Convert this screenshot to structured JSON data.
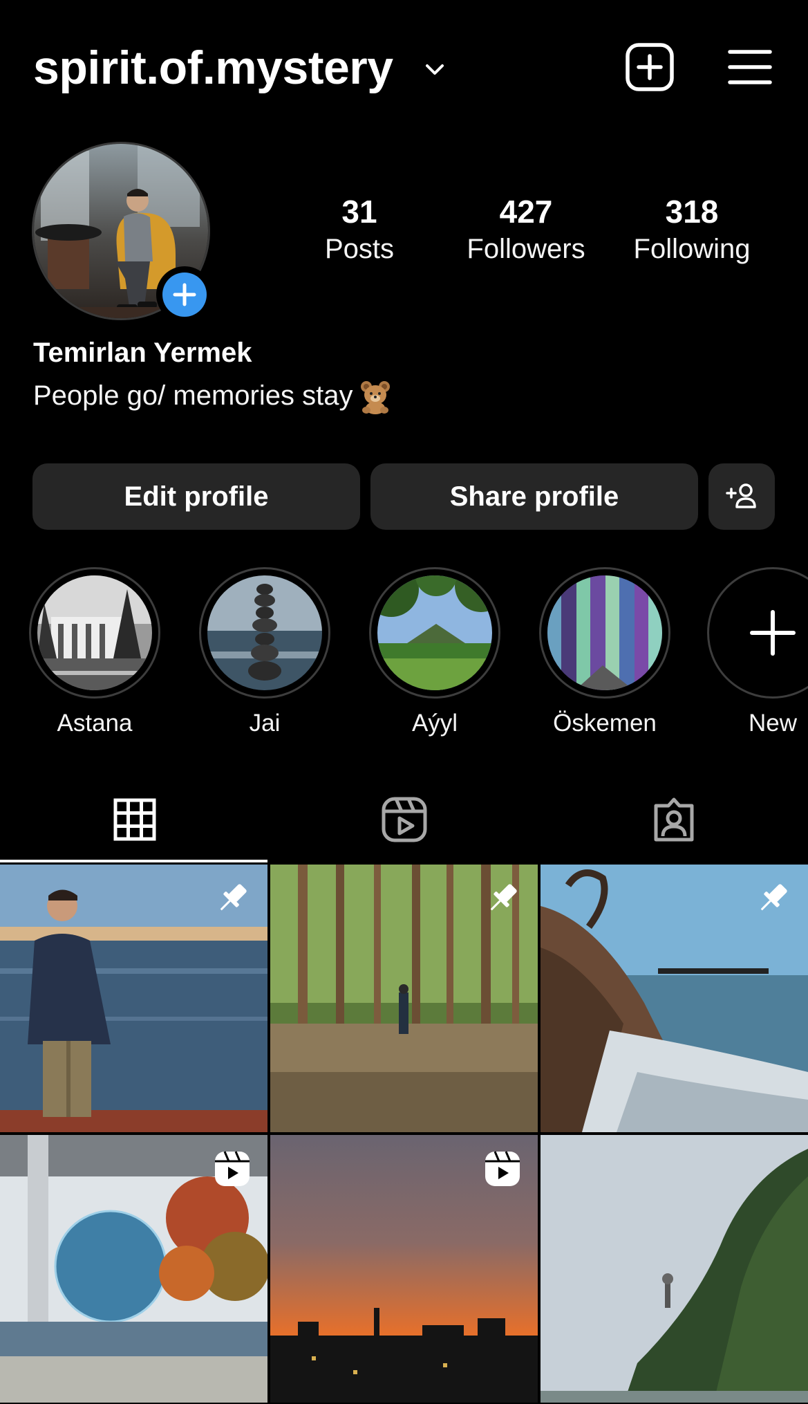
{
  "header": {
    "username": "spirit.of.mystery",
    "icons": [
      "chevron-down-icon",
      "new-post-icon",
      "menu-icon"
    ]
  },
  "profile": {
    "stats": [
      {
        "value": "31",
        "label": "Posts"
      },
      {
        "value": "427",
        "label": "Followers"
      },
      {
        "value": "318",
        "label": "Following"
      }
    ],
    "full_name": "Temirlan Yermek",
    "bio": "People go/ memories stay"
  },
  "actions": {
    "edit_label": "Edit profile",
    "share_label": "Share profile"
  },
  "highlights": [
    {
      "label": "Astana"
    },
    {
      "label": "Jai"
    },
    {
      "label": "Aýyl"
    },
    {
      "label": "Öskemen"
    },
    {
      "label": "New"
    }
  ],
  "tabs": [
    "grid-tab",
    "reels-tab",
    "tagged-tab"
  ],
  "colors": {
    "background": "#000000",
    "button": "#262626",
    "accent": "#3897f0"
  },
  "posts": [
    {
      "badge": "pin-icon"
    },
    {
      "badge": "pin-icon"
    },
    {
      "badge": "pin-icon"
    },
    {
      "badge": "reel-icon"
    },
    {
      "badge": "reel-icon"
    },
    {
      "badge": ""
    }
  ]
}
